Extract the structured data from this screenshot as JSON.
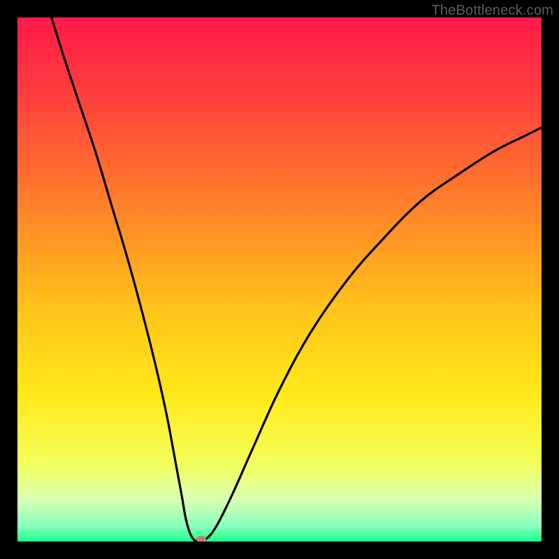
{
  "watermark": "TheBottleneck.com",
  "colors": {
    "frame": "#000000",
    "gradient_stops": [
      {
        "offset": 0.0,
        "color": "#ff1a4a"
      },
      {
        "offset": 0.15,
        "color": "#ff3f3d"
      },
      {
        "offset": 0.35,
        "color": "#ff7e2a"
      },
      {
        "offset": 0.55,
        "color": "#ffc21a"
      },
      {
        "offset": 0.72,
        "color": "#ffe91a"
      },
      {
        "offset": 0.85,
        "color": "#f4ff59"
      },
      {
        "offset": 0.92,
        "color": "#d9ffb2"
      },
      {
        "offset": 0.97,
        "color": "#8affc0"
      },
      {
        "offset": 1.0,
        "color": "#1aff8a"
      }
    ],
    "curve": "#000000",
    "marker": "#c57b72"
  },
  "chart_data": {
    "type": "line",
    "title": "",
    "xlabel": "",
    "ylabel": "",
    "xlim": [
      0,
      1
    ],
    "ylim": [
      0,
      1
    ],
    "series": [
      {
        "name": "bottleneck-curve",
        "points": [
          {
            "x": 0.065,
            "y": 1.0
          },
          {
            "x": 0.09,
            "y": 0.92
          },
          {
            "x": 0.12,
            "y": 0.83
          },
          {
            "x": 0.15,
            "y": 0.74
          },
          {
            "x": 0.18,
            "y": 0.64
          },
          {
            "x": 0.21,
            "y": 0.54
          },
          {
            "x": 0.24,
            "y": 0.43
          },
          {
            "x": 0.265,
            "y": 0.33
          },
          {
            "x": 0.285,
            "y": 0.24
          },
          {
            "x": 0.3,
            "y": 0.16
          },
          {
            "x": 0.313,
            "y": 0.09
          },
          {
            "x": 0.322,
            "y": 0.04
          },
          {
            "x": 0.332,
            "y": 0.01
          },
          {
            "x": 0.344,
            "y": 0.0
          },
          {
            "x": 0.36,
            "y": 0.005
          },
          {
            "x": 0.38,
            "y": 0.03
          },
          {
            "x": 0.41,
            "y": 0.09
          },
          {
            "x": 0.45,
            "y": 0.18
          },
          {
            "x": 0.5,
            "y": 0.29
          },
          {
            "x": 0.56,
            "y": 0.4
          },
          {
            "x": 0.63,
            "y": 0.5
          },
          {
            "x": 0.7,
            "y": 0.58
          },
          {
            "x": 0.77,
            "y": 0.65
          },
          {
            "x": 0.84,
            "y": 0.7
          },
          {
            "x": 0.91,
            "y": 0.745
          },
          {
            "x": 0.97,
            "y": 0.775
          },
          {
            "x": 1.0,
            "y": 0.79
          }
        ]
      }
    ],
    "marker": {
      "x": 0.351,
      "y": 0.0
    },
    "annotations": []
  }
}
